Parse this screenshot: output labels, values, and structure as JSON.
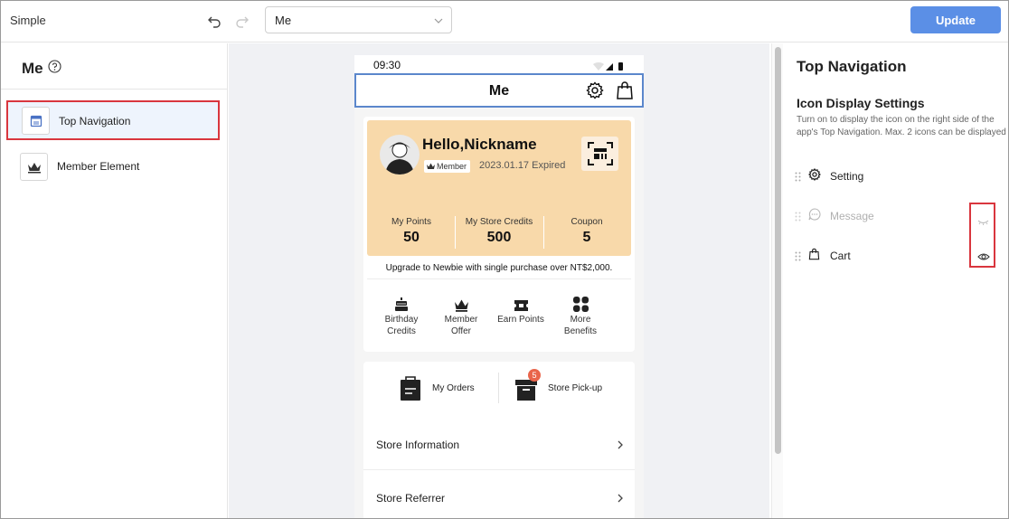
{
  "header": {
    "app_title": "Simple",
    "page_select_value": "Me",
    "update_label": "Update"
  },
  "left_panel": {
    "title": "Me",
    "items": [
      {
        "label": "Top Navigation",
        "selected": true,
        "icon": "layout-icon"
      },
      {
        "label": "Member Element",
        "selected": false,
        "icon": "crown-icon"
      }
    ]
  },
  "preview": {
    "status_time": "09:30",
    "nav_title": "Me",
    "nav_icons": [
      "gear-icon",
      "bag-icon"
    ],
    "member_card": {
      "greeting": "Hello,Nickname",
      "badge": "Member",
      "expiry": "2023.01.17 Expired",
      "stats": [
        {
          "label": "My Points",
          "value": "50"
        },
        {
          "label": "My Store Credits",
          "value": "500"
        },
        {
          "label": "Coupon",
          "value": "5"
        }
      ]
    },
    "upgrade_text": "Upgrade to Newbie with single purchase over NT$2,000.",
    "benefits": [
      {
        "line1": "Birthday",
        "line2": "Credits",
        "icon": "cake-icon"
      },
      {
        "line1": "Member",
        "line2": "Offer",
        "icon": "crown-icon"
      },
      {
        "line1": "Earn Points",
        "line2": "",
        "icon": "ticket-icon"
      },
      {
        "line1": "More",
        "line2": "Benefits",
        "icon": "grid-icon"
      }
    ],
    "orders": [
      {
        "label": "My Orders",
        "badge": ""
      },
      {
        "label": "Store Pick-up",
        "badge": "5"
      }
    ],
    "rows": [
      {
        "label": "Store Information"
      },
      {
        "label": "Store Referrer"
      }
    ]
  },
  "right_panel": {
    "title": "Top Navigation",
    "subtitle": "Icon Display Settings",
    "description": "Turn on to display the icon on the right side of the app's Top Navigation. Max. 2 icons can be displayed",
    "icons": [
      {
        "label": "Setting",
        "icon": "gear-icon",
        "visible": null
      },
      {
        "label": "Message",
        "icon": "message-icon",
        "visible": false
      },
      {
        "label": "Cart",
        "icon": "bag-icon",
        "visible": true
      }
    ]
  },
  "colors": {
    "accent": "#5b8fe6",
    "highlight": "#d9363e",
    "card": "#f8d9aa",
    "badge": "#e9654b"
  }
}
